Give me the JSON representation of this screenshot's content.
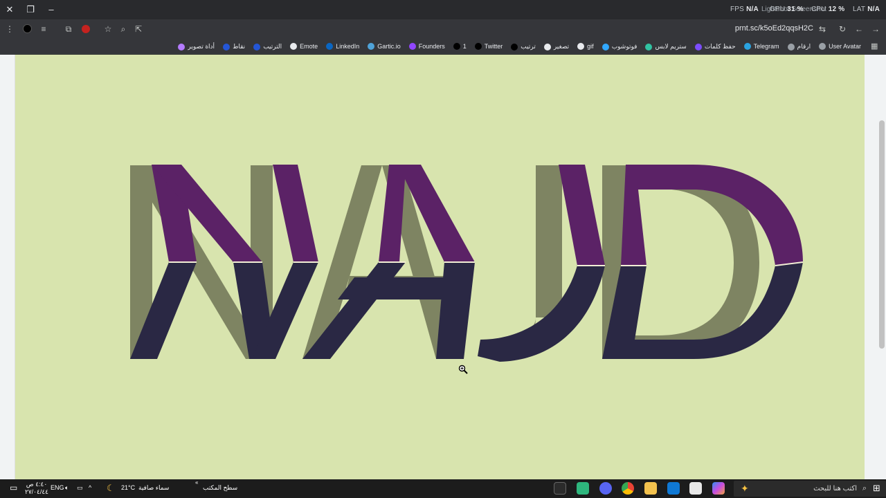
{
  "stats": {
    "fps_label": "FPS",
    "fps_value": "N/A",
    "gpu_label": "GPU",
    "gpu_value": "31 %",
    "cpu_label": "CPU",
    "cpu_value": "12 %",
    "lat_label": "LAT",
    "lat_value": "N/A"
  },
  "tab": {
    "ghost_title": "Lightshot Screenshot"
  },
  "toolbar": {
    "url": "prnt.sc/k5oEd2qqsH2C"
  },
  "bookmarks": [
    {
      "label": "User Avatar",
      "color": "#9aa0a6"
    },
    {
      "label": "ارقام",
      "color": "#9aa0a6"
    },
    {
      "label": "Telegram",
      "color": "#2aa3e0"
    },
    {
      "label": "حفظ كلمات",
      "color": "#7c4dff"
    },
    {
      "label": "ستريم لابس",
      "color": "#31c3a2"
    },
    {
      "label": "فوتوشوب",
      "color": "#31a8ff"
    },
    {
      "label": "gif",
      "color": "#e8eaed"
    },
    {
      "label": "تصغير",
      "color": "#e8eaed"
    },
    {
      "label": "ترتيب",
      "color": "#000000"
    },
    {
      "label": "Twitter",
      "color": "#000000"
    },
    {
      "label": "1",
      "color": "#000000"
    },
    {
      "label": "Founders",
      "color": "#9146ff"
    },
    {
      "label": "Gartic.io",
      "color": "#4fa3d9"
    },
    {
      "label": "LinkedIn",
      "color": "#0a66c2"
    },
    {
      "label": "Emote",
      "color": "#e8eaed"
    },
    {
      "label": "الترتيب",
      "color": "#2456d6"
    },
    {
      "label": "نقاط",
      "color": "#2456d6"
    },
    {
      "label": "أداة تصوير",
      "color": "#b47bff"
    }
  ],
  "artwork": {
    "word": "NAJD",
    "colors": {
      "background": "#d8e4ae",
      "shadow": "#7e8462",
      "top": "#5b2266",
      "bottom": "#2a2844",
      "seam": "#f3efd6"
    }
  },
  "taskbar": {
    "search_placeholder": "اكتب هنا للبحث",
    "desktop_label": "سطح المكتب",
    "weather_text": "سماء صافية",
    "temperature": "21°C",
    "language": "ENG",
    "time": "٤:٤٠ ص",
    "date": "٢٧/٠٤/٤٤"
  }
}
